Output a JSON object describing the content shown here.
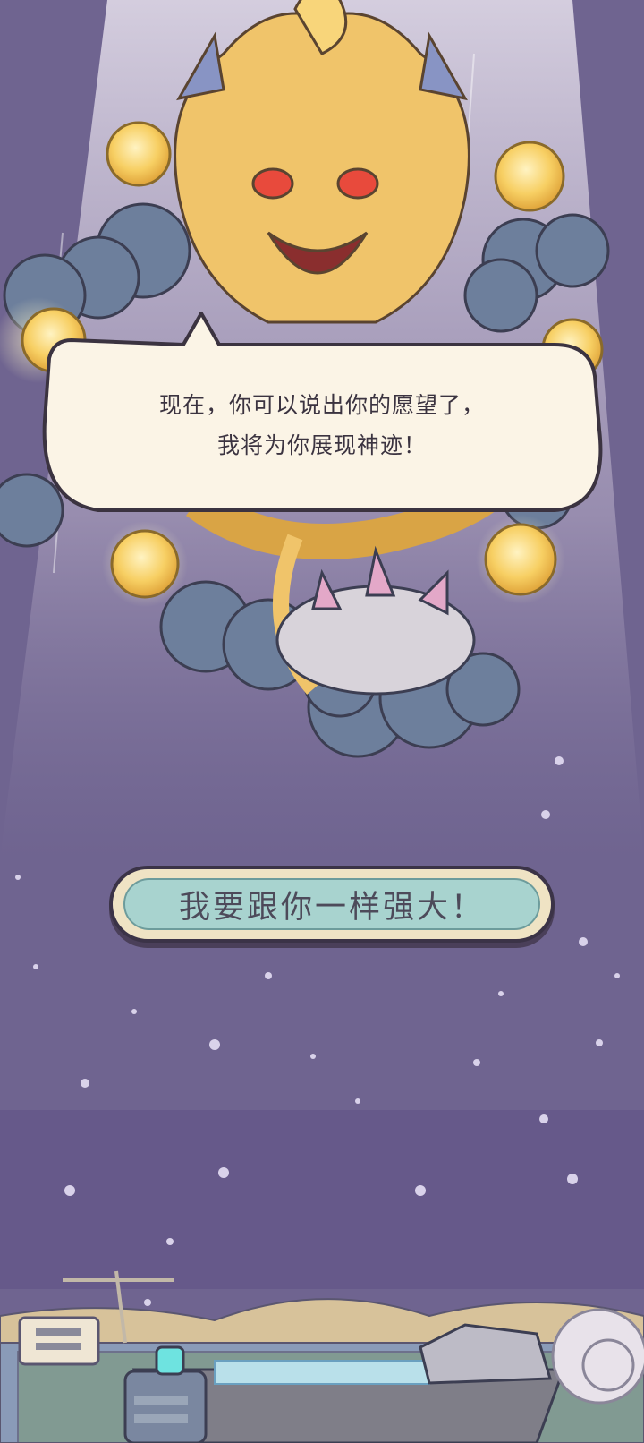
{
  "dialog": {
    "line1": "现在，你可以说出你的愿望了，",
    "line2": "我将为你展现神迹！"
  },
  "choice_button": {
    "label": "我要跟你一样强大！"
  },
  "colors": {
    "background": "#6f6490",
    "button_face": "#a8d3cf",
    "bubble": "#fbf4e6",
    "dragon": "#f0c46a"
  }
}
